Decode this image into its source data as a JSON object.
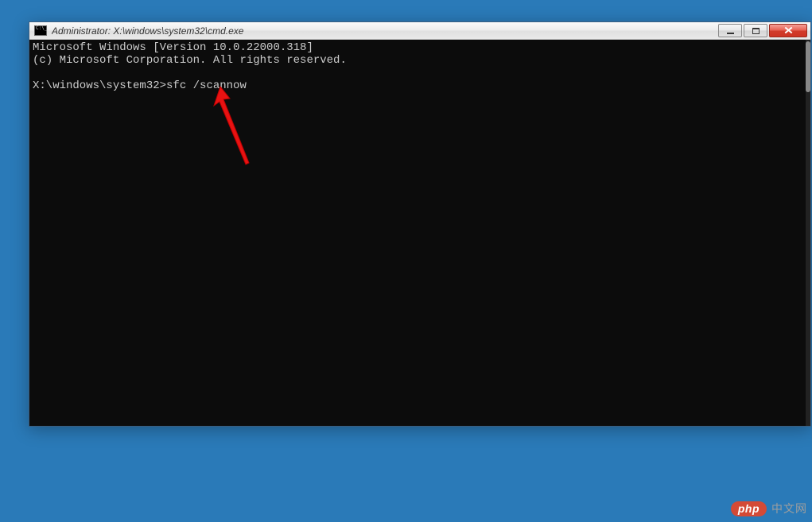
{
  "window": {
    "title": "Administrator: X:\\windows\\system32\\cmd.exe"
  },
  "console": {
    "line1": "Microsoft Windows [Version 10.0.22000.318]",
    "line2": "(c) Microsoft Corporation. All rights reserved.",
    "prompt": "X:\\windows\\system32>",
    "command": "sfc /scannow"
  },
  "watermark": {
    "brand": "php",
    "text": "中文网"
  }
}
